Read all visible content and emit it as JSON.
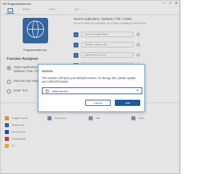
{
  "window": {
    "title": "HP Programmable Key",
    "minimize": "─",
    "maximize": "□",
    "close": "✕"
  },
  "tabs": {
    "items": [
      "SHIFT +",
      "CTRL +",
      "ALT +"
    ],
    "home_icon": "home-key-icon"
  },
  "left_panel": {
    "key_icon": "globe-icon",
    "key_label": "Programmable Key",
    "function_label": "Function Assigned",
    "options": [
      {
        "label": "Open Application / Website / File / Folder",
        "selected": true
      },
      {
        "label": "Execute Key Sequence",
        "selected": false
      },
      {
        "label": "Enter Text",
        "selected": false
      }
    ]
  },
  "right_panel": {
    "title": "Search Application / Website / File / Folder",
    "subtitle": "Choose to launch an application, file or folder by adding an action below.",
    "slots": [
      {
        "num": "1",
        "value": "Launch Google Chrome"
      },
      {
        "num": "2",
        "value": "Website: www.hp.com"
      },
      {
        "num": "3",
        "value": "Launch Word & Excel"
      },
      {
        "num": "4",
        "value": "Launch Certificate .pdf"
      }
    ]
  },
  "bottom": {
    "segments": [
      "KEY 1",
      "CTRL +",
      "ALT +"
    ],
    "favorites": [
      {
        "label": "Google Chrome",
        "color": "#e6a33a"
      },
      {
        "label": "Screenshot",
        "color": "#7a8fb0"
      },
      {
        "label": "website.com",
        "color": "#3a6fb0"
      },
      {
        "label": "Word & Excel",
        "color": "#2e5a9f"
      },
      {
        "label": "Certificate.pdf",
        "color": "#d04a3a"
      },
      {
        "label": "Pic",
        "color": "#f2c23c"
      },
      {
        "label": "Mail",
        "color": "#9a9a9a"
      },
      {
        "label": "Music",
        "color": "#9a9a9a"
      }
    ]
  },
  "dialog": {
    "title": "Website",
    "message": "The website will open your default browser. To change this, please update your default browser.",
    "input_value": "www.hp.com",
    "info_icon": "info-icon",
    "clear_icon": "✕",
    "cancel_label": "Cancel",
    "add_label": "Add"
  },
  "colors": {
    "accent": "#1e5b9b",
    "key_tile": "#3a6fb0",
    "dialog_border": "#6aa0cf"
  }
}
